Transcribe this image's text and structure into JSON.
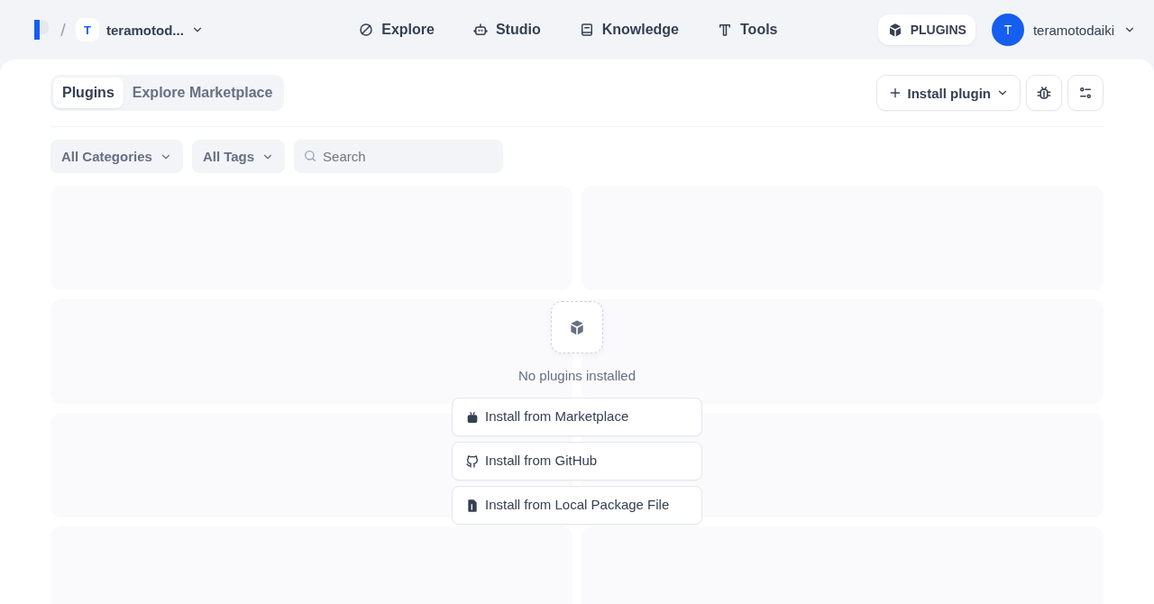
{
  "header": {
    "workspace": {
      "initial": "T",
      "name": "teramotod..."
    },
    "nav": [
      {
        "label": "Explore",
        "kind": "explore",
        "selected": false
      },
      {
        "label": "Studio",
        "kind": "studio",
        "selected": false
      },
      {
        "label": "Knowledge",
        "kind": "knowledge",
        "selected": false
      },
      {
        "label": "Tools",
        "kind": "tools",
        "selected": false
      }
    ],
    "plugins_button": {
      "label": "PLUGINS",
      "selected": true
    },
    "user": {
      "initial": "T",
      "name": "teramotodaiki"
    }
  },
  "tabs": [
    {
      "label": "Plugins",
      "selected": true
    },
    {
      "label": "Explore Marketplace",
      "selected": false
    }
  ],
  "install_button": {
    "label": "Install plugin"
  },
  "filters": [
    {
      "label": "All Categories"
    },
    {
      "label": "All Tags"
    }
  ],
  "search": {
    "placeholder": "Search"
  },
  "empty_state": {
    "message": "No plugins installed",
    "actions": [
      {
        "label": "Install from Marketplace",
        "kind": "marketplace"
      },
      {
        "label": "Install from GitHub",
        "kind": "github"
      },
      {
        "label": "Install from Local Package File",
        "kind": "file"
      }
    ]
  }
}
